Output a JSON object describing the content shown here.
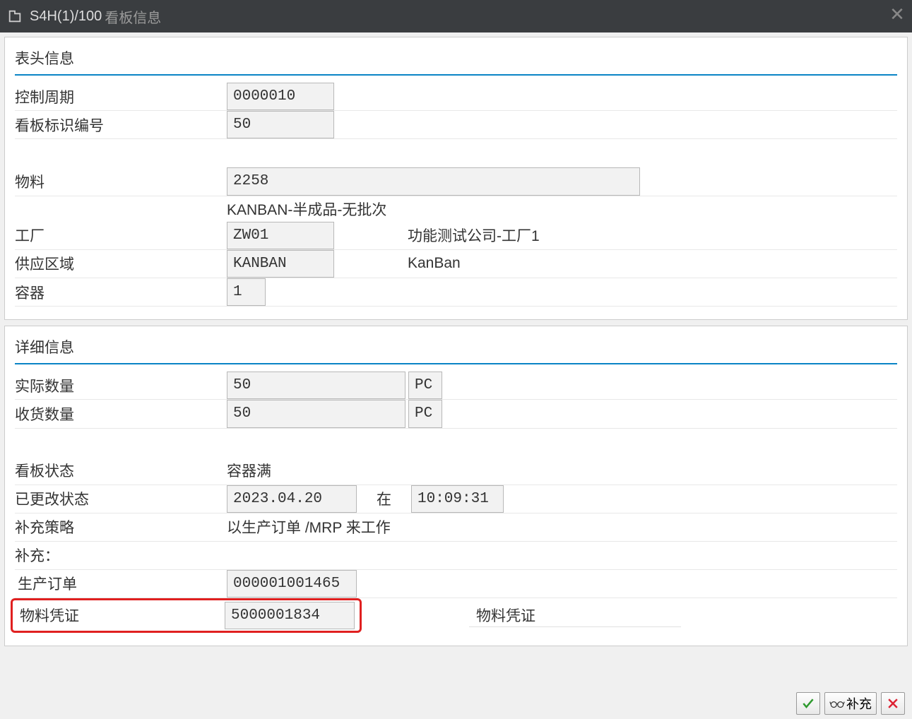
{
  "titlebar": {
    "system": "S4H(1)/100",
    "title": "看板信息"
  },
  "header_section": {
    "title": "表头信息",
    "control_cycle_label": "控制周期",
    "control_cycle_value": "0000010",
    "kanban_id_label": "看板标识编号",
    "kanban_id_value": "50",
    "material_label": "物料",
    "material_value": "2258",
    "material_desc": "KANBAN-半成品-无批次",
    "plant_label": "工厂",
    "plant_value": "ZW01",
    "plant_desc": "功能测试公司-工厂1",
    "supply_area_label": "供应区域",
    "supply_area_value": "KANBAN",
    "supply_area_desc": "KanBan",
    "container_label": "容器",
    "container_value": "1"
  },
  "detail_section": {
    "title": "详细信息",
    "actual_qty_label": "实际数量",
    "actual_qty_value": "50",
    "actual_qty_uom": "PC",
    "gr_qty_label": "收货数量",
    "gr_qty_value": "50",
    "gr_qty_uom": "PC",
    "kanban_status_label": "看板状态",
    "kanban_status_value": "容器满",
    "changed_status_label": "已更改状态",
    "changed_date": "2023.04.20",
    "at_label": "在",
    "changed_time": "10:09:31",
    "strategy_label": "补充策略",
    "strategy_value": "以生产订单 /MRP 来工作",
    "replenish_label": "补充：",
    "prod_order_label": "生产订单",
    "prod_order_value": "000001001465",
    "mat_doc_label": "物料凭证",
    "mat_doc_value": "5000001834",
    "mat_doc_side_label": "物料凭证"
  },
  "footer": {
    "replenish_button": "补充"
  }
}
